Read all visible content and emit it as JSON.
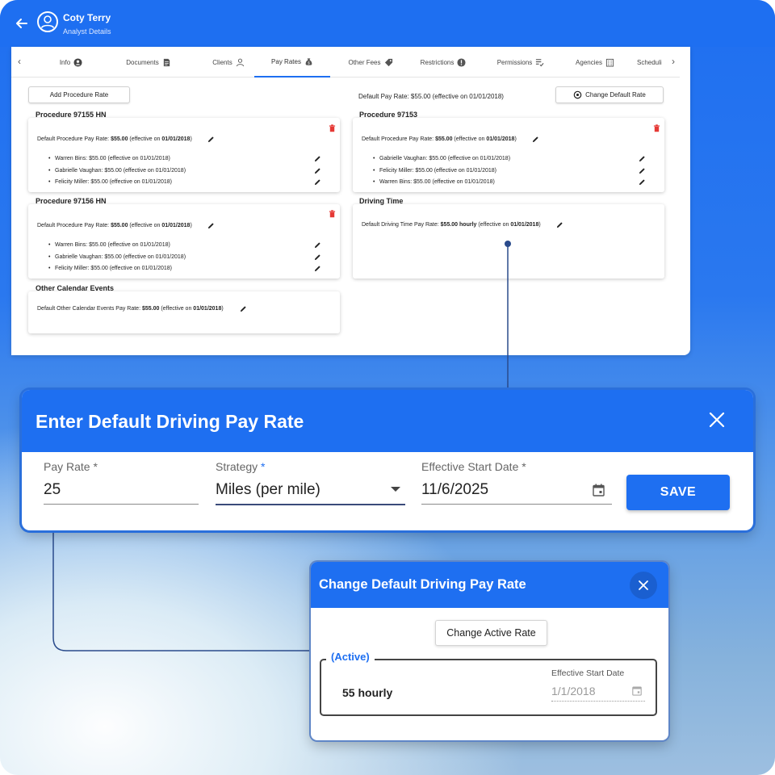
{
  "header": {
    "name": "Coty Terry",
    "subtitle": "Analyst Details"
  },
  "tabs": [
    {
      "label": "Info",
      "icon": "person-circle-icon"
    },
    {
      "label": "Documents",
      "icon": "document-icon"
    },
    {
      "label": "Clients",
      "icon": "client-icon"
    },
    {
      "label": "Pay Rates",
      "icon": "money-bag-icon",
      "active": true
    },
    {
      "label": "Other Fees",
      "icon": "tag-icon"
    },
    {
      "label": "Restrictions",
      "icon": "alert-icon"
    },
    {
      "label": "Permissions",
      "icon": "checklist-icon"
    },
    {
      "label": "Agencies",
      "icon": "building-icon"
    },
    {
      "label": "Scheduli",
      "icon": ""
    }
  ],
  "toolbar": {
    "add_procedure_rate": "Add Procedure Rate",
    "default_pay_rate_text": "Default Pay Rate: $55.00 (effective on 01/01/2018)",
    "change_default_rate": "Change Default Rate"
  },
  "cards": {
    "p97155": {
      "title": "Procedure 97155 HN",
      "default_prefix": "Default Procedure Pay Rate: ",
      "default_amount": "$55.00",
      "default_mid": " (effective on ",
      "default_date": "01/01/2018",
      "default_suffix": ")",
      "items": [
        "Warren Bins: $55.00 (effective on 01/01/2018)",
        "Gabrielle Vaughan: $55.00 (effective on 01/01/2018)",
        "Felicity Miller: $55.00 (effective on 01/01/2018)"
      ]
    },
    "p97153": {
      "title": "Procedure 97153",
      "default_prefix": "Default Procedure Pay Rate: ",
      "default_amount": "$55.00",
      "default_mid": " (effective on ",
      "default_date": "01/01/2018",
      "default_suffix": ")",
      "items": [
        "Gabrielle Vaughan: $55.00 (effective on 01/01/2018)",
        "Felicity Miller: $55.00 (effective on 01/01/2018)",
        "Warren Bins: $55.00 (effective on 01/01/2018)"
      ]
    },
    "p97156": {
      "title": "Procedure 97156 HN",
      "default_prefix": "Default Procedure Pay Rate: ",
      "default_amount": "$55.00",
      "default_mid": " (effective on ",
      "default_date": "01/01/2018",
      "default_suffix": ")",
      "items": [
        "Warren Bins: $55.00 (effective on 01/01/2018)",
        "Gabrielle Vaughan: $55.00 (effective on 01/01/2018)",
        "Felicity Miller: $55.00 (effective on 01/01/2018)"
      ]
    },
    "driving": {
      "title": "Driving Time",
      "default_prefix": "Default Driving Time Pay Rate: ",
      "default_amount": "$55.00 hourly",
      "default_mid": " (effective on ",
      "default_date": "01/01/2018",
      "default_suffix": ")"
    },
    "other": {
      "title": "Other Calendar Events",
      "default_prefix": "Default Other Calendar Events Pay Rate: ",
      "default_amount": "$55.00",
      "default_mid": " (effective on ",
      "default_date": "01/01/2018",
      "default_suffix": ")"
    }
  },
  "dialog_enter": {
    "title": "Enter Default Driving Pay Rate",
    "pay_rate_label": "Pay Rate",
    "pay_rate_value": "25",
    "strategy_label": "Strategy",
    "strategy_value": "Miles (per mile)",
    "start_date_label": "Effective Start Date",
    "start_date_value": "11/6/2025",
    "required_mark": "*",
    "save": "SAVE"
  },
  "dialog_change": {
    "title": "Change Default Driving Pay Rate",
    "change_active_rate": "Change Active Rate",
    "active_legend": "(Active)",
    "active_value": "55 hourly",
    "start_date_label": "Effective Start Date",
    "start_date_value": "1/1/2018"
  },
  "colors": {
    "primary": "#1e6ff1",
    "danger": "#e53935"
  }
}
